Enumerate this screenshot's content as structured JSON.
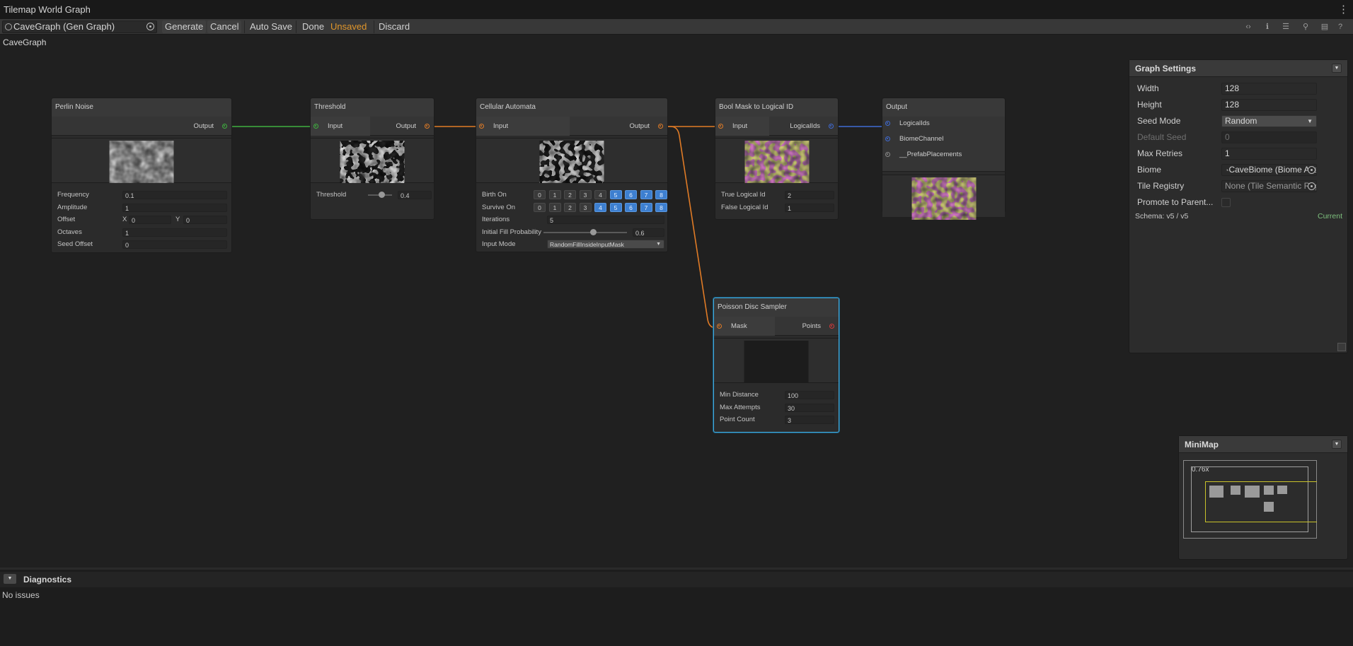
{
  "window": {
    "title": "Tilemap World Graph"
  },
  "toolbar": {
    "graph_field": "CaveGraph (Gen Graph)",
    "generate": "Generate",
    "cancel": "Cancel",
    "auto_save": "Auto Save",
    "done": "Done",
    "unsaved": "Unsaved",
    "discard": "Discard",
    "unsaved_color": "#e0962b",
    "right_icons": [
      "code-icon",
      "info-icon",
      "list-icon",
      "zoom-icon",
      "document-icon",
      "help-icon"
    ]
  },
  "breadcrumb": "CaveGraph",
  "nodes": {
    "perlin": {
      "title": "Perlin Noise",
      "output": "Output",
      "fields": {
        "frequency_label": "Frequency",
        "frequency": "0.1",
        "amplitude_label": "Amplitude",
        "amplitude": "1",
        "offset_label": "Offset",
        "offset_x_label": "X",
        "offset_x": "0",
        "offset_y_label": "Y",
        "offset_y": "0",
        "octaves_label": "Octaves",
        "octaves": "1",
        "seed_offset_label": "Seed Offset",
        "seed_offset": "0"
      }
    },
    "threshold": {
      "title": "Threshold",
      "input": "Input",
      "output": "Output",
      "threshold_label": "Threshold",
      "threshold": "0.4",
      "threshold_level": 0.4
    },
    "cellular": {
      "title": "Cellular Automata",
      "input": "Input",
      "output": "Output",
      "birth_label": "Birth On",
      "survive_label": "Survive On",
      "digits": [
        "0",
        "1",
        "2",
        "3",
        "4",
        "5",
        "6",
        "7",
        "8"
      ],
      "birth_on": [
        false,
        false,
        false,
        false,
        false,
        true,
        true,
        true,
        true
      ],
      "survive_on": [
        false,
        false,
        false,
        false,
        true,
        true,
        true,
        true,
        true
      ],
      "iterations_label": "Iterations",
      "iterations": "5",
      "fill_label": "Initial Fill Probability",
      "fill": "0.6",
      "fill_level": 0.6,
      "input_mode_label": "Input Mode",
      "input_mode": "RandomFillInsideInputMask"
    },
    "boolmask": {
      "title": "Bool Mask to Logical ID",
      "input": "Input",
      "output": "LogicalIds",
      "true_label": "True Logical Id",
      "true_value": "2",
      "false_label": "False Logical Id",
      "false_value": "1"
    },
    "output": {
      "title": "Output",
      "ports": [
        "LogicalIds",
        "BiomeChannel",
        "__PrefabPlacements"
      ]
    },
    "poisson": {
      "title": "Poisson Disc Sampler",
      "input": "Mask",
      "output": "Points",
      "min_distance_label": "Min Distance",
      "min_distance": "100",
      "max_attempts_label": "Max Attempts",
      "max_attempts": "30",
      "point_count_label": "Point Count",
      "point_count": "3"
    }
  },
  "port_colors": {
    "float": "#3fb03f",
    "bool": "#e07b26",
    "int": "#3f6ad4",
    "points": "#d23a3a",
    "neutral": "#8a8a8a"
  },
  "graph_settings": {
    "title": "Graph Settings",
    "width_label": "Width",
    "width": "128",
    "height_label": "Height",
    "height": "128",
    "seed_mode_label": "Seed Mode",
    "seed_mode": "Random",
    "default_seed_label": "Default Seed",
    "default_seed": "0",
    "max_retries_label": "Max Retries",
    "max_retries": "1",
    "biome_label": "Biome",
    "biome": "CaveBiome (Biome Ass",
    "tile_registry_label": "Tile Registry",
    "tile_registry": "None (Tile Semantic Regi",
    "promote_label": "Promote to Parent...",
    "schema": "Schema: v5 / v5",
    "schema_status": "Current"
  },
  "minimap": {
    "title": "MiniMap",
    "zoom": "0.76x"
  },
  "diagnostics": {
    "title": "Diagnostics",
    "message": "No issues"
  }
}
